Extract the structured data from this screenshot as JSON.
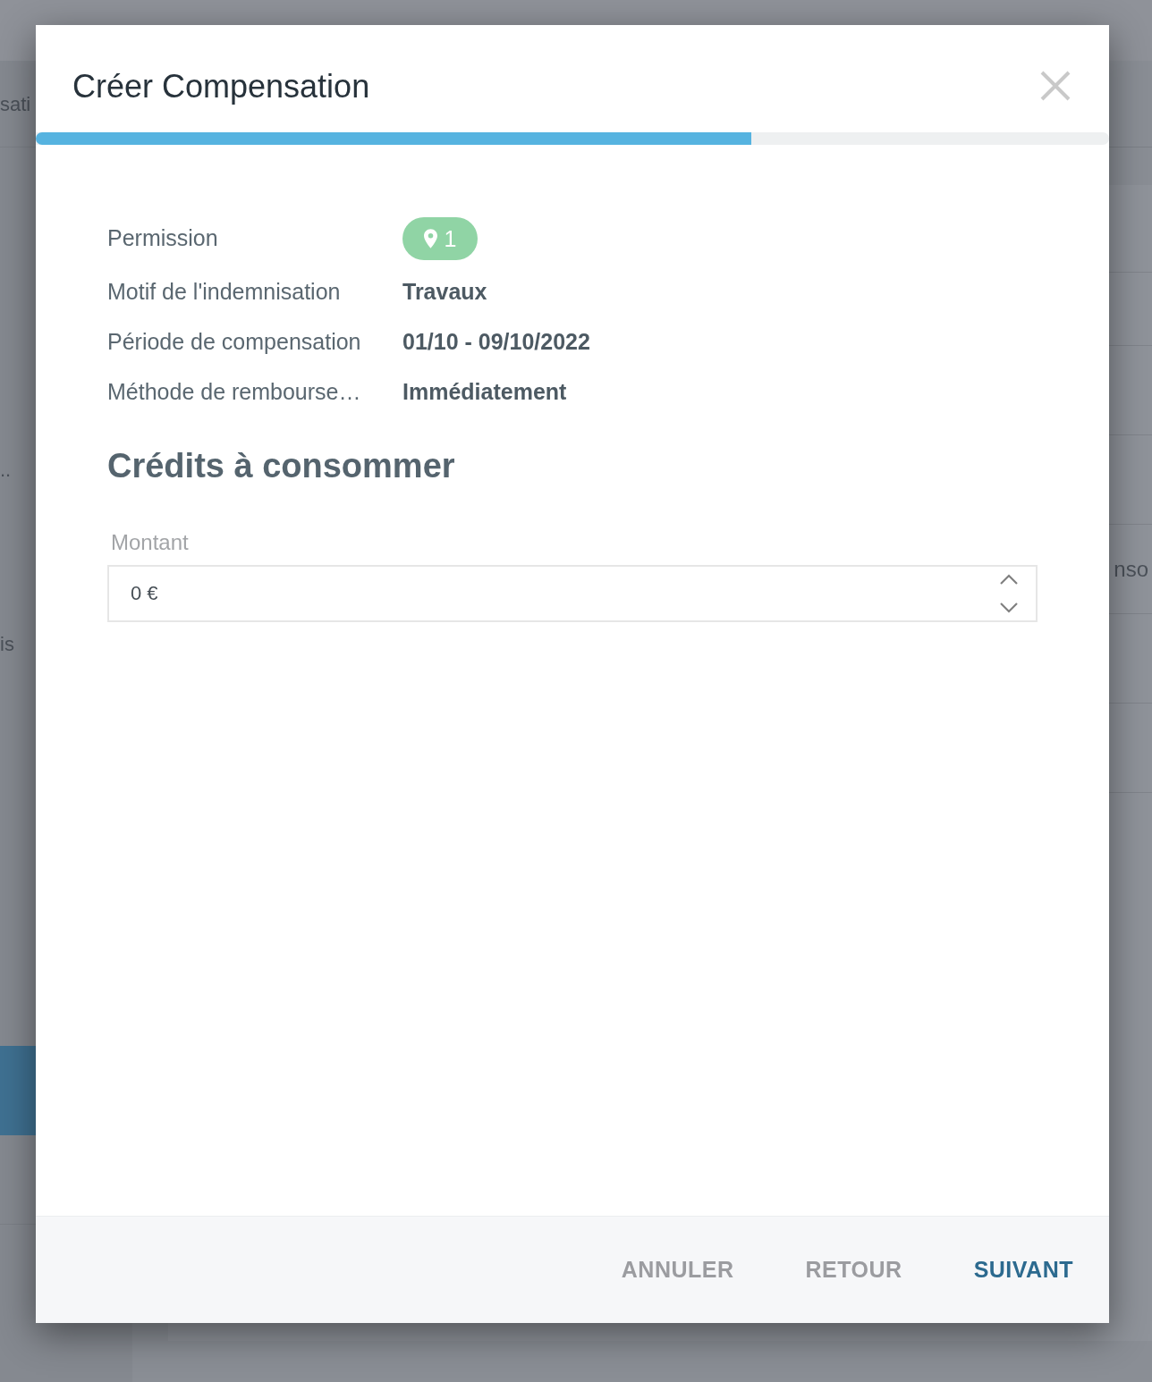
{
  "background": {
    "left_column": [
      "sati",
      "..",
      "is"
    ],
    "right_column": [
      "nso"
    ]
  },
  "window": {
    "title": "Créer Compensation"
  },
  "progress": {
    "level": 0.667
  },
  "details": [
    {
      "kind": "badge",
      "label": "Permission",
      "value": "1"
    },
    {
      "kind": "text",
      "label": "Motif de l'indemnisation",
      "value": "Travaux"
    },
    {
      "kind": "text",
      "label": "Période de compensation",
      "value": "01/10 - 09/10/2022"
    },
    {
      "kind": "text",
      "label": "Méthode de rembourse…",
      "value": "Immédiatement"
    }
  ],
  "section": {
    "title": "Crédits à consommer"
  },
  "amount_field": {
    "label": "Montant",
    "value": "0 €"
  },
  "buttons": [
    {
      "label": "ANNULER",
      "kind": "secondary"
    },
    {
      "label": "RETOUR",
      "kind": "secondary"
    },
    {
      "label": "SUIVANT",
      "kind": "primary"
    }
  ]
}
